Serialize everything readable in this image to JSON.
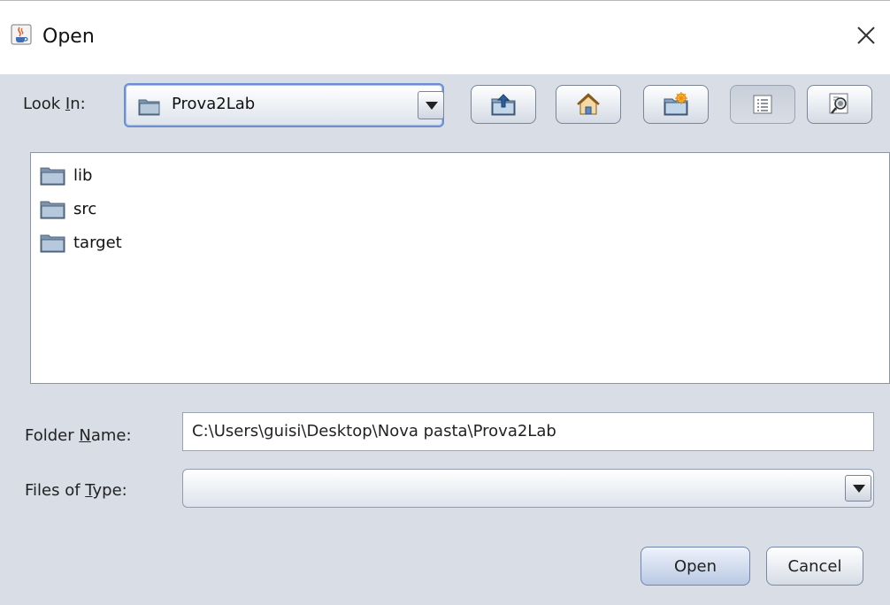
{
  "window": {
    "title": "Open",
    "app_icon": "java-cup-icon",
    "close_icon": "close-icon"
  },
  "look_in": {
    "label_pre": "Look ",
    "label_mnemonic": "I",
    "label_post": "n:",
    "value": "Prova2Lab"
  },
  "toolbar": {
    "buttons": [
      {
        "name": "up-one-level-button",
        "icon": "folder-up-icon"
      },
      {
        "name": "home-button",
        "icon": "home-icon"
      },
      {
        "name": "new-folder-button",
        "icon": "new-folder-icon"
      },
      {
        "name": "list-view-button",
        "icon": "list-view-icon",
        "pressed": true
      },
      {
        "name": "details-view-button",
        "icon": "details-view-icon"
      }
    ]
  },
  "files": [
    {
      "name": "lib",
      "icon": "folder-icon"
    },
    {
      "name": "src",
      "icon": "folder-icon"
    },
    {
      "name": "target",
      "icon": "folder-icon"
    }
  ],
  "folder_name": {
    "label_pre": "Folder ",
    "label_mnemonic": "N",
    "label_post": "ame:",
    "value": "C:\\Users\\guisi\\Desktop\\Nova pasta\\Prova2Lab"
  },
  "files_of_type": {
    "label_pre": "Files of ",
    "label_mnemonic": "T",
    "label_post": "ype:",
    "value": ""
  },
  "actions": {
    "open": "Open",
    "cancel": "Cancel"
  },
  "colors": {
    "panel": "#d8dde6",
    "primary_button": "#b9c9e3",
    "focus_border": "#6b8fd1"
  }
}
